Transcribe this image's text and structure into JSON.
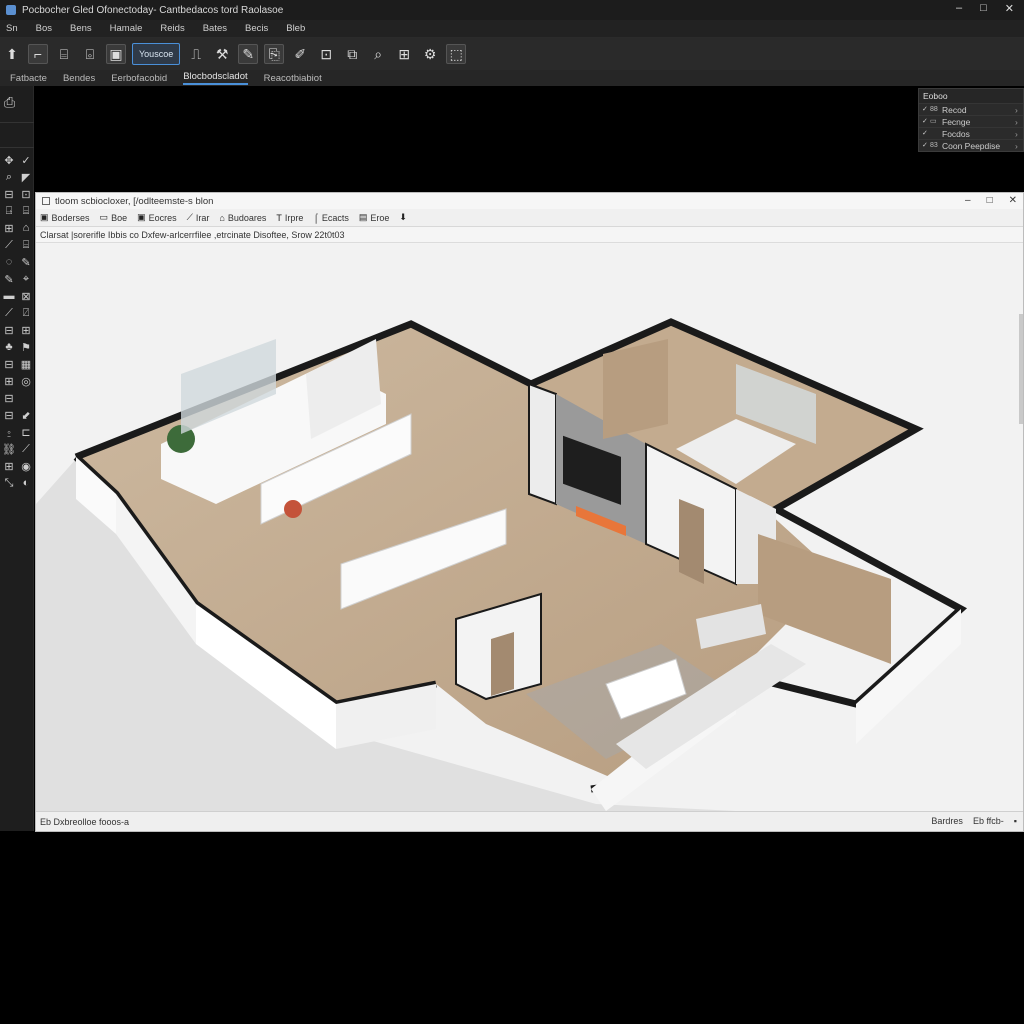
{
  "window": {
    "title": "Pocbocher Gled Ofonectoday- Cantbedacos tord Raolasoe",
    "controls": [
      "–",
      "□",
      "✕"
    ]
  },
  "menubar": {
    "items": [
      "Sn",
      "Bos",
      "Bens",
      "Hamale",
      "Reids",
      "Bates",
      "Becis",
      "Bleb"
    ]
  },
  "toolbar": {
    "selected_label": "Youscoe"
  },
  "ribbon_tabs": [
    "Fatbacte",
    "Bendes",
    "Eerbofacobid",
    "Blocbodscladot",
    "Reacotbiabiot"
  ],
  "props_panel": {
    "title": "Eoboo",
    "rows": [
      {
        "icon": "88",
        "label": "Recod"
      },
      {
        "icon": "▭",
        "label": "Fecnge"
      },
      {
        "icon": "",
        "label": "Focdos"
      },
      {
        "icon": "83",
        "label": "Coon Peepdise"
      }
    ]
  },
  "doc": {
    "title": "tloom scbiocloxer, [/odlteemste-s blon",
    "controls": [
      "–",
      "□",
      "✕"
    ],
    "toolbar": [
      {
        "icon": "▣",
        "label": "Boderses"
      },
      {
        "icon": "▭",
        "label": "Boe"
      },
      {
        "icon": "▣",
        "label": "Eocres"
      },
      {
        "icon": "⟋",
        "label": "Irar"
      },
      {
        "icon": "⌂",
        "label": "Budoares"
      },
      {
        "icon": "T",
        "label": "Irpre"
      },
      {
        "icon": "⌠",
        "label": "Ecacts"
      },
      {
        "icon": "▤",
        "label": "Eroe"
      },
      {
        "icon": "⬇",
        "label": ""
      }
    ],
    "info": "Clarsat |sorerifle   Ibbis co Dxfew-arlcerrfilee ,etrcinate   Disoftee,   Srow 22t0t03",
    "status_left": "Eb Dxbreolloe fooos-a",
    "status_right": [
      "Bardres",
      "Eb ffcb-",
      "▪"
    ]
  }
}
